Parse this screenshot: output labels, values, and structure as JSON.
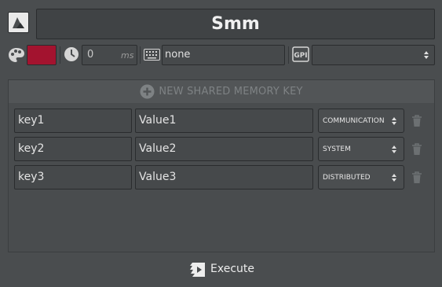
{
  "header": {
    "title": "Smm"
  },
  "toolbar": {
    "color": "#a3132f",
    "delay_value": "0",
    "delay_unit": "ms",
    "shortcut_value": "none",
    "gpi_value": ""
  },
  "panel": {
    "add_label": "NEW SHARED MEMORY KEY",
    "rows": [
      {
        "key": "key1",
        "value": "Value1",
        "type": "COMMUNICATION"
      },
      {
        "key": "key2",
        "value": "Value2",
        "type": "SYSTEM"
      },
      {
        "key": "key3",
        "value": "Value3",
        "type": "DISTRIBUTED"
      }
    ]
  },
  "footer": {
    "execute_label": "Execute"
  }
}
